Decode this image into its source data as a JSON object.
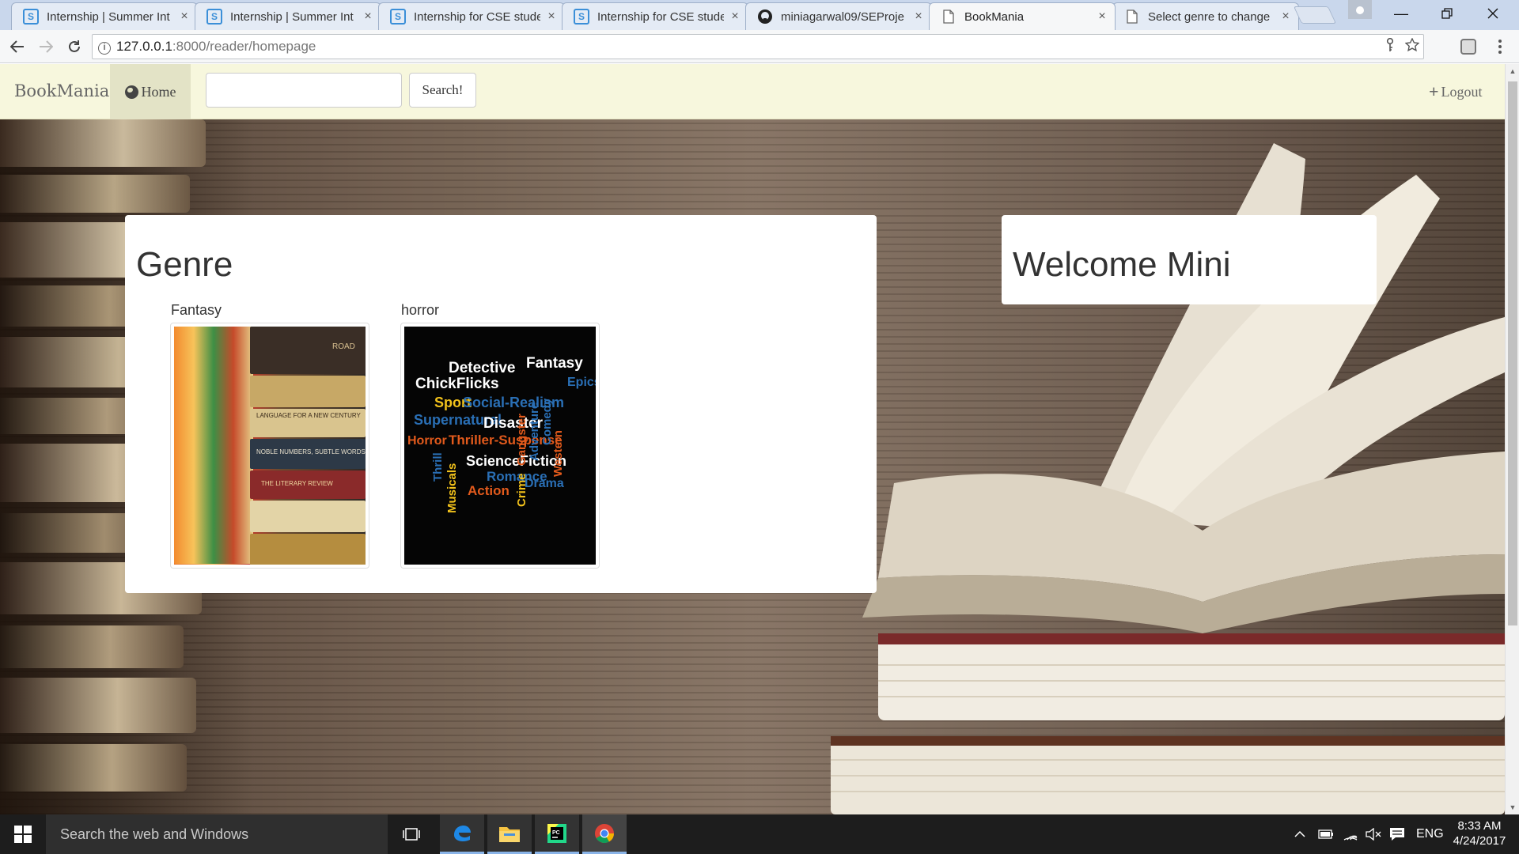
{
  "browser": {
    "tabs": [
      {
        "title": "Internship | Summer Int",
        "favicon": "internshala-icon",
        "active": false
      },
      {
        "title": "Internship | Summer Int",
        "favicon": "internshala-icon",
        "active": false
      },
      {
        "title": "Internship for CSE stude",
        "favicon": "internshala-icon",
        "active": false
      },
      {
        "title": "Internship for CSE stude",
        "favicon": "internshala-icon",
        "active": false
      },
      {
        "title": "miniagarwal09/SEProje",
        "favicon": "github-icon",
        "active": false
      },
      {
        "title": "BookMania",
        "favicon": "page-icon",
        "active": true
      },
      {
        "title": "Select genre to change",
        "favicon": "page-icon",
        "active": false
      }
    ],
    "tab_favicon_letter": "S",
    "close_glyph": "×",
    "url_host": "127.0.0.1",
    "url_rest": ":8000/reader/homepage",
    "info_glyph": "i"
  },
  "app": {
    "brand": "BookMania",
    "nav_home": "Home",
    "search_value": "",
    "search_button": "Search!",
    "logout": "Logout",
    "genre_heading": "Genre",
    "welcome_heading": "Welcome Mini",
    "genres": [
      {
        "name": "Fantasy"
      },
      {
        "name": "horror"
      }
    ],
    "fantasy_spines": [
      "LANGUAGE FOR A NEW CENTURY",
      "NOBLE NUMBERS, SUBTLE WORDS",
      "THE LITERARY REVIEW",
      "ROAD"
    ],
    "horror_words": [
      "Detective",
      "Fantasy",
      "ChickFlicks",
      "Sport",
      "Social-Realism",
      "Epics",
      "Supernatural",
      "Disaster",
      "Horror",
      "Thriller-Suspense",
      "ScienceFiction",
      "Romance",
      "Action",
      "Thrill",
      "Musicals",
      "Crime",
      "Gangster",
      "Adventure",
      "Comedy",
      "Western",
      "Drama"
    ]
  },
  "taskbar": {
    "search_placeholder": "Search the web and Windows",
    "language": "ENG",
    "time": "8:33 AM",
    "date": "4/24/2017"
  },
  "colors": {
    "navbar_bg": "#f7f7dd",
    "home_active_bg": "#e3e3c6",
    "taskbar_bg": "#1d1d1d"
  }
}
